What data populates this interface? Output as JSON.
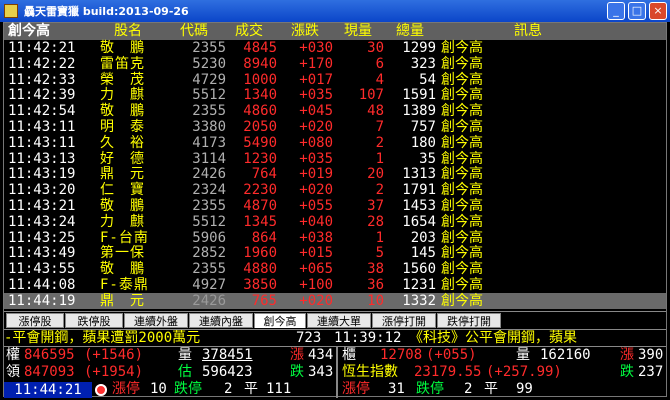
{
  "window": {
    "title": "驫天雷寶獵 build:2013-09-26",
    "min": "_",
    "max": "□",
    "close": "×"
  },
  "header": {
    "filter": "創今高",
    "name": "股名",
    "code": "代碼",
    "deal": "成交",
    "change": "漲跌",
    "volume": "現量",
    "total": "總量",
    "msg": "訊息"
  },
  "rows": [
    {
      "time": "11:42:21",
      "name": "敬　鵬",
      "code": "2355",
      "deal": "4845",
      "change": "+030",
      "volume": "30",
      "total": "1299",
      "msg": "創今高"
    },
    {
      "time": "11:42:22",
      "name": "雷笛克",
      "code": "5230",
      "deal": "8940",
      "change": "+170",
      "volume": "6",
      "total": "323",
      "msg": "創今高"
    },
    {
      "time": "11:42:33",
      "name": "榮　茂",
      "code": "4729",
      "deal": "1000",
      "change": "+017",
      "volume": "4",
      "total": "54",
      "msg": "創今高"
    },
    {
      "time": "11:42:39",
      "name": "力　麒",
      "code": "5512",
      "deal": "1340",
      "change": "+035",
      "volume": "107",
      "total": "1591",
      "msg": "創今高"
    },
    {
      "time": "11:42:54",
      "name": "敬　鵬",
      "code": "2355",
      "deal": "4860",
      "change": "+045",
      "volume": "48",
      "total": "1389",
      "msg": "創今高"
    },
    {
      "time": "11:43:11",
      "name": "明　泰",
      "code": "3380",
      "deal": "2050",
      "change": "+020",
      "volume": "7",
      "total": "757",
      "msg": "創今高"
    },
    {
      "time": "11:43:11",
      "name": "久　裕",
      "code": "4173",
      "deal": "5490",
      "change": "+080",
      "volume": "2",
      "total": "180",
      "msg": "創今高"
    },
    {
      "time": "11:43:13",
      "name": "好　德",
      "code": "3114",
      "deal": "1230",
      "change": "+035",
      "volume": "1",
      "total": "35",
      "msg": "創今高"
    },
    {
      "time": "11:43:19",
      "name": "鼎　元",
      "code": "2426",
      "deal": "764",
      "change": "+019",
      "volume": "20",
      "total": "1313",
      "msg": "創今高"
    },
    {
      "time": "11:43:20",
      "name": "仁　寶",
      "code": "2324",
      "deal": "2230",
      "change": "+020",
      "volume": "2",
      "total": "1791",
      "msg": "創今高"
    },
    {
      "time": "11:43:21",
      "name": "敬　鵬",
      "code": "2355",
      "deal": "4870",
      "change": "+055",
      "volume": "37",
      "total": "1453",
      "msg": "創今高"
    },
    {
      "time": "11:43:24",
      "name": "力　麒",
      "code": "5512",
      "deal": "1345",
      "change": "+040",
      "volume": "28",
      "total": "1654",
      "msg": "創今高"
    },
    {
      "time": "11:43:25",
      "name": "F-台南",
      "code": "5906",
      "deal": "864",
      "change": "+038",
      "volume": "1",
      "total": "203",
      "msg": "創今高"
    },
    {
      "time": "11:43:49",
      "name": "第一保",
      "code": "2852",
      "deal": "1960",
      "change": "+015",
      "volume": "5",
      "total": "145",
      "msg": "創今高"
    },
    {
      "time": "11:43:55",
      "name": "敬　鵬",
      "code": "2355",
      "deal": "4880",
      "change": "+065",
      "volume": "38",
      "total": "1560",
      "msg": "創今高"
    },
    {
      "time": "11:44:08",
      "name": "F-泰鼎",
      "code": "4927",
      "deal": "3850",
      "change": "+100",
      "volume": "36",
      "total": "1231",
      "msg": "創今高"
    },
    {
      "time": "11:44:19",
      "name": "鼎　元",
      "code": "2426",
      "deal": "765",
      "change": "+020",
      "volume": "10",
      "total": "1332",
      "msg": "創今高"
    }
  ],
  "tabs": [
    "漲停股",
    "跌停股",
    "連續外盤",
    "連續內盤",
    "創今高",
    "連續大單",
    "漲停打開",
    "跌停打開"
  ],
  "active_tab": "創今高",
  "ticker": {
    "left": "-平會開鋼，蘋果遭罰2000萬元",
    "mid": "723",
    "time": "11:39:12",
    "right": "《科技》公平會開鋼，蘋果"
  },
  "left_stats": {
    "r1": {
      "label": "權",
      "value": "846595",
      "chg": "(+1546)",
      "vol_label": "量",
      "vol": "378451",
      "up_label": "漲",
      "up": "434"
    },
    "r2": {
      "label": "領",
      "value": "847093",
      "chg": "(+1954)",
      "est_label": "估",
      "est": "596423",
      "down_label": "跌",
      "down": "343"
    },
    "r3": {
      "time": "11:44:21",
      "limit_up_label": "漲停",
      "limit_up": "10",
      "limit_down_label": "跌停",
      "limit_down": "2",
      "flat_label": "平",
      "flat": "111"
    }
  },
  "right_stats": {
    "r1": {
      "label": "櫃",
      "value": "12708",
      "chg": "(+055)",
      "vol_label": "量",
      "vol": "162160",
      "up_label": "漲",
      "up": "390"
    },
    "r2": {
      "label": "恆生指數",
      "value": "23179.55",
      "chg": "(+257.99)",
      "down_label": "跌",
      "down": "237"
    },
    "r3": {
      "limit_up_label": "漲停",
      "limit_up": "31",
      "limit_down_label": "跌停",
      "limit_down": "2",
      "flat_label": "平",
      "flat": "99"
    }
  },
  "colors": {
    "up": "#ff2b2b",
    "name": "#ffff00",
    "neutral": "#ffffff",
    "code": "#b0b0b0",
    "accent": "#00e0ff",
    "green": "#00ff40"
  }
}
